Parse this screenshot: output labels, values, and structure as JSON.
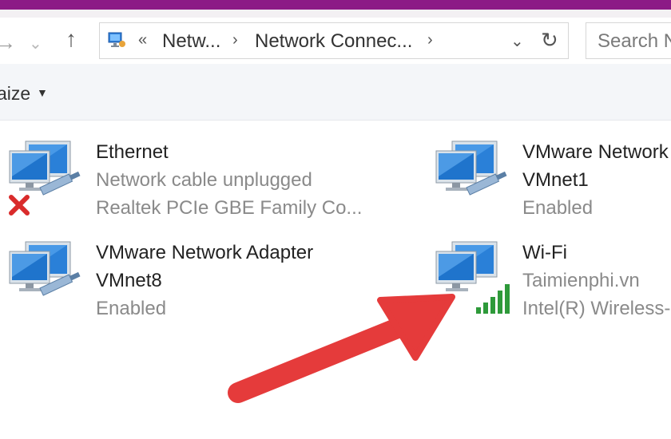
{
  "window": {
    "accent": "#8c1a86"
  },
  "nav": {
    "back_icon": "back-arrow-icon",
    "forward_icon": "forward-arrow-icon",
    "up_icon": "up-arrow-icon"
  },
  "address": {
    "overflow_chevron": "«",
    "crumb1": "Netw...",
    "crumb2": "Network Connec...",
    "separator": "›"
  },
  "search": {
    "placeholder": "Search N"
  },
  "toolbar": {
    "organize_label": "aize"
  },
  "connections": [
    {
      "name": "Ethernet",
      "status": "Network cable unplugged",
      "device": "Realtek PCIe GBE Family Co...",
      "state_icon": "disconnected-x-icon"
    },
    {
      "name": "VMware Network",
      "status": "VMnet1",
      "device": "Enabled",
      "state_icon": "cable-icon"
    },
    {
      "name": "VMware Network Adapter",
      "status": "VMnet8",
      "device": "Enabled",
      "state_icon": "cable-icon"
    },
    {
      "name": "Wi-Fi",
      "status": "Taimienphi.vn",
      "device": "Intel(R) Wireless-",
      "state_icon": "wifi-signal-icon"
    }
  ],
  "annotation": {
    "arrow_color": "#e53b3b"
  }
}
